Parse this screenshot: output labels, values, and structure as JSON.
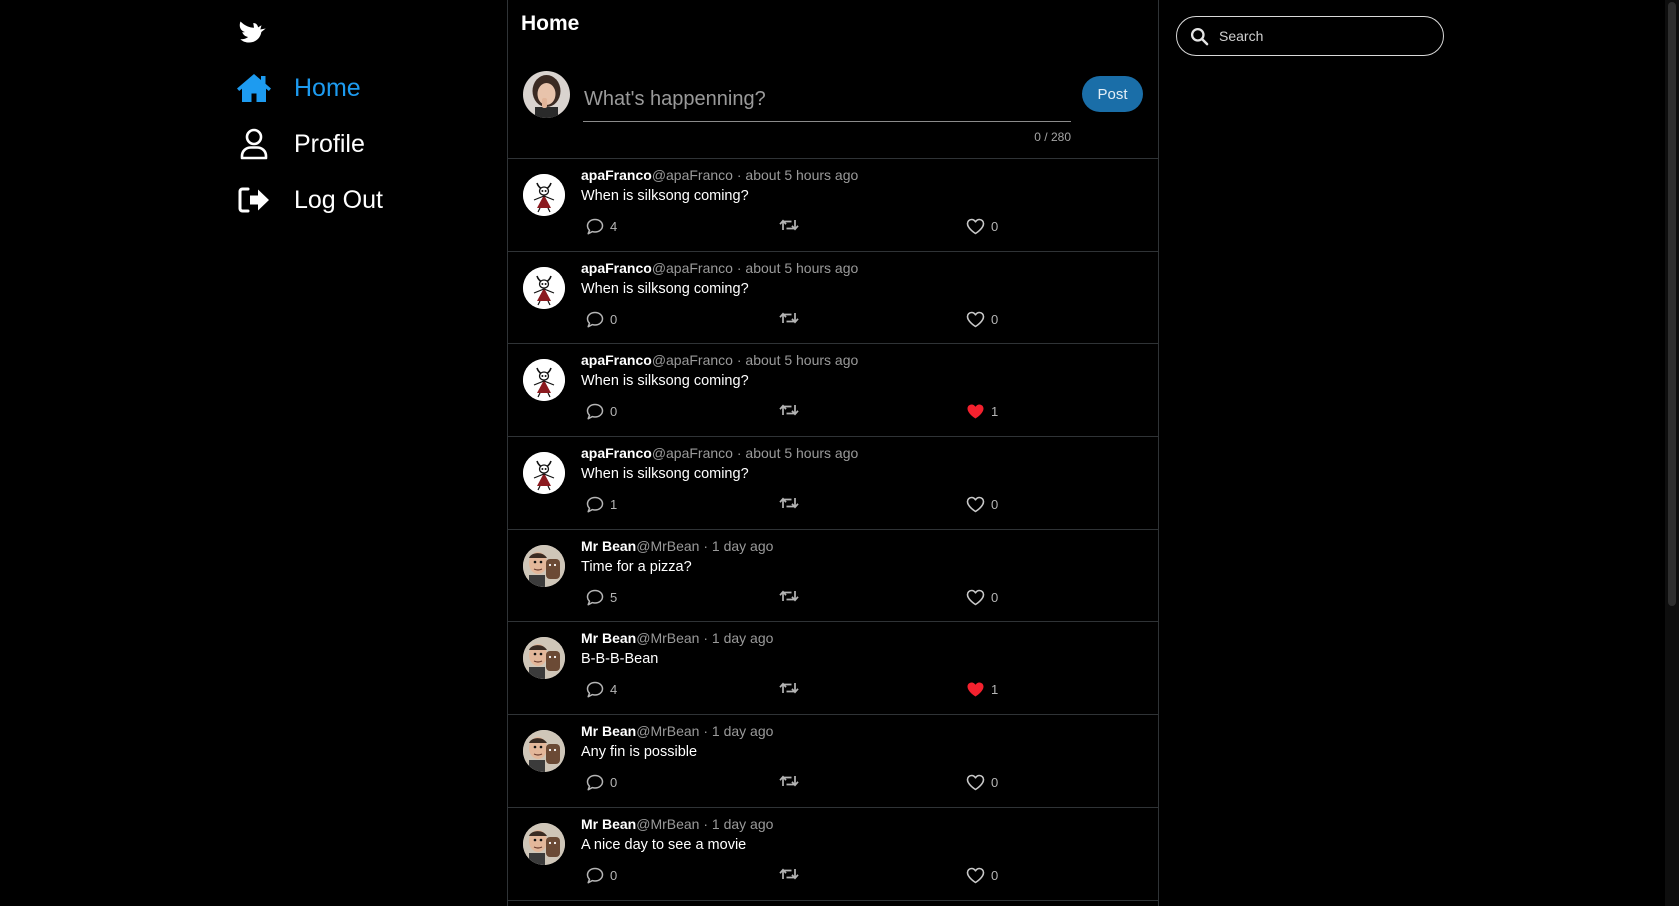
{
  "nav": {
    "items": [
      {
        "label": "Home",
        "icon": "home-icon",
        "active": true
      },
      {
        "label": "Profile",
        "icon": "user-icon",
        "active": false
      },
      {
        "label": "Log Out",
        "icon": "logout-icon",
        "active": false
      }
    ]
  },
  "main": {
    "title": "Home",
    "composer": {
      "placeholder": "What's happenning?",
      "counter": "0 / 280",
      "post_label": "Post"
    }
  },
  "feed": [
    {
      "name": "apaFranco",
      "handle": "@apaFranco",
      "sep": "·",
      "time": "about 5 hours ago",
      "text": "When is silksong coming?",
      "replies": "4",
      "likes": "0",
      "liked": false,
      "avatar": "hornet"
    },
    {
      "name": "apaFranco",
      "handle": "@apaFranco",
      "sep": "·",
      "time": "about 5 hours ago",
      "text": "When is silksong coming?",
      "replies": "0",
      "likes": "0",
      "liked": false,
      "avatar": "hornet"
    },
    {
      "name": "apaFranco",
      "handle": "@apaFranco",
      "sep": "·",
      "time": "about 5 hours ago",
      "text": "When is silksong coming?",
      "replies": "0",
      "likes": "1",
      "liked": true,
      "avatar": "hornet"
    },
    {
      "name": "apaFranco",
      "handle": "@apaFranco",
      "sep": "·",
      "time": "about 5 hours ago",
      "text": "When is silksong coming?",
      "replies": "1",
      "likes": "0",
      "liked": false,
      "avatar": "hornet"
    },
    {
      "name": "Mr Bean",
      "handle": "@MrBean",
      "sep": "·",
      "time": "1 day ago",
      "text": "Time for a pizza?",
      "replies": "5",
      "likes": "0",
      "liked": false,
      "avatar": "bean"
    },
    {
      "name": "Mr Bean",
      "handle": "@MrBean",
      "sep": "·",
      "time": "1 day ago",
      "text": "B-B-B-Bean",
      "replies": "4",
      "likes": "1",
      "liked": true,
      "avatar": "bean"
    },
    {
      "name": "Mr Bean",
      "handle": "@MrBean",
      "sep": "·",
      "time": "1 day ago",
      "text": "Any fin is possible",
      "replies": "0",
      "likes": "0",
      "liked": false,
      "avatar": "bean"
    },
    {
      "name": "Mr Bean",
      "handle": "@MrBean",
      "sep": "·",
      "time": "1 day ago",
      "text": "A nice day to see a movie",
      "replies": "0",
      "likes": "0",
      "liked": false,
      "avatar": "bean"
    }
  ],
  "search": {
    "placeholder": "Search"
  },
  "colors": {
    "accent": "#1d9bf0",
    "like": "#f4212e",
    "post_button": "#1a6ea8"
  }
}
